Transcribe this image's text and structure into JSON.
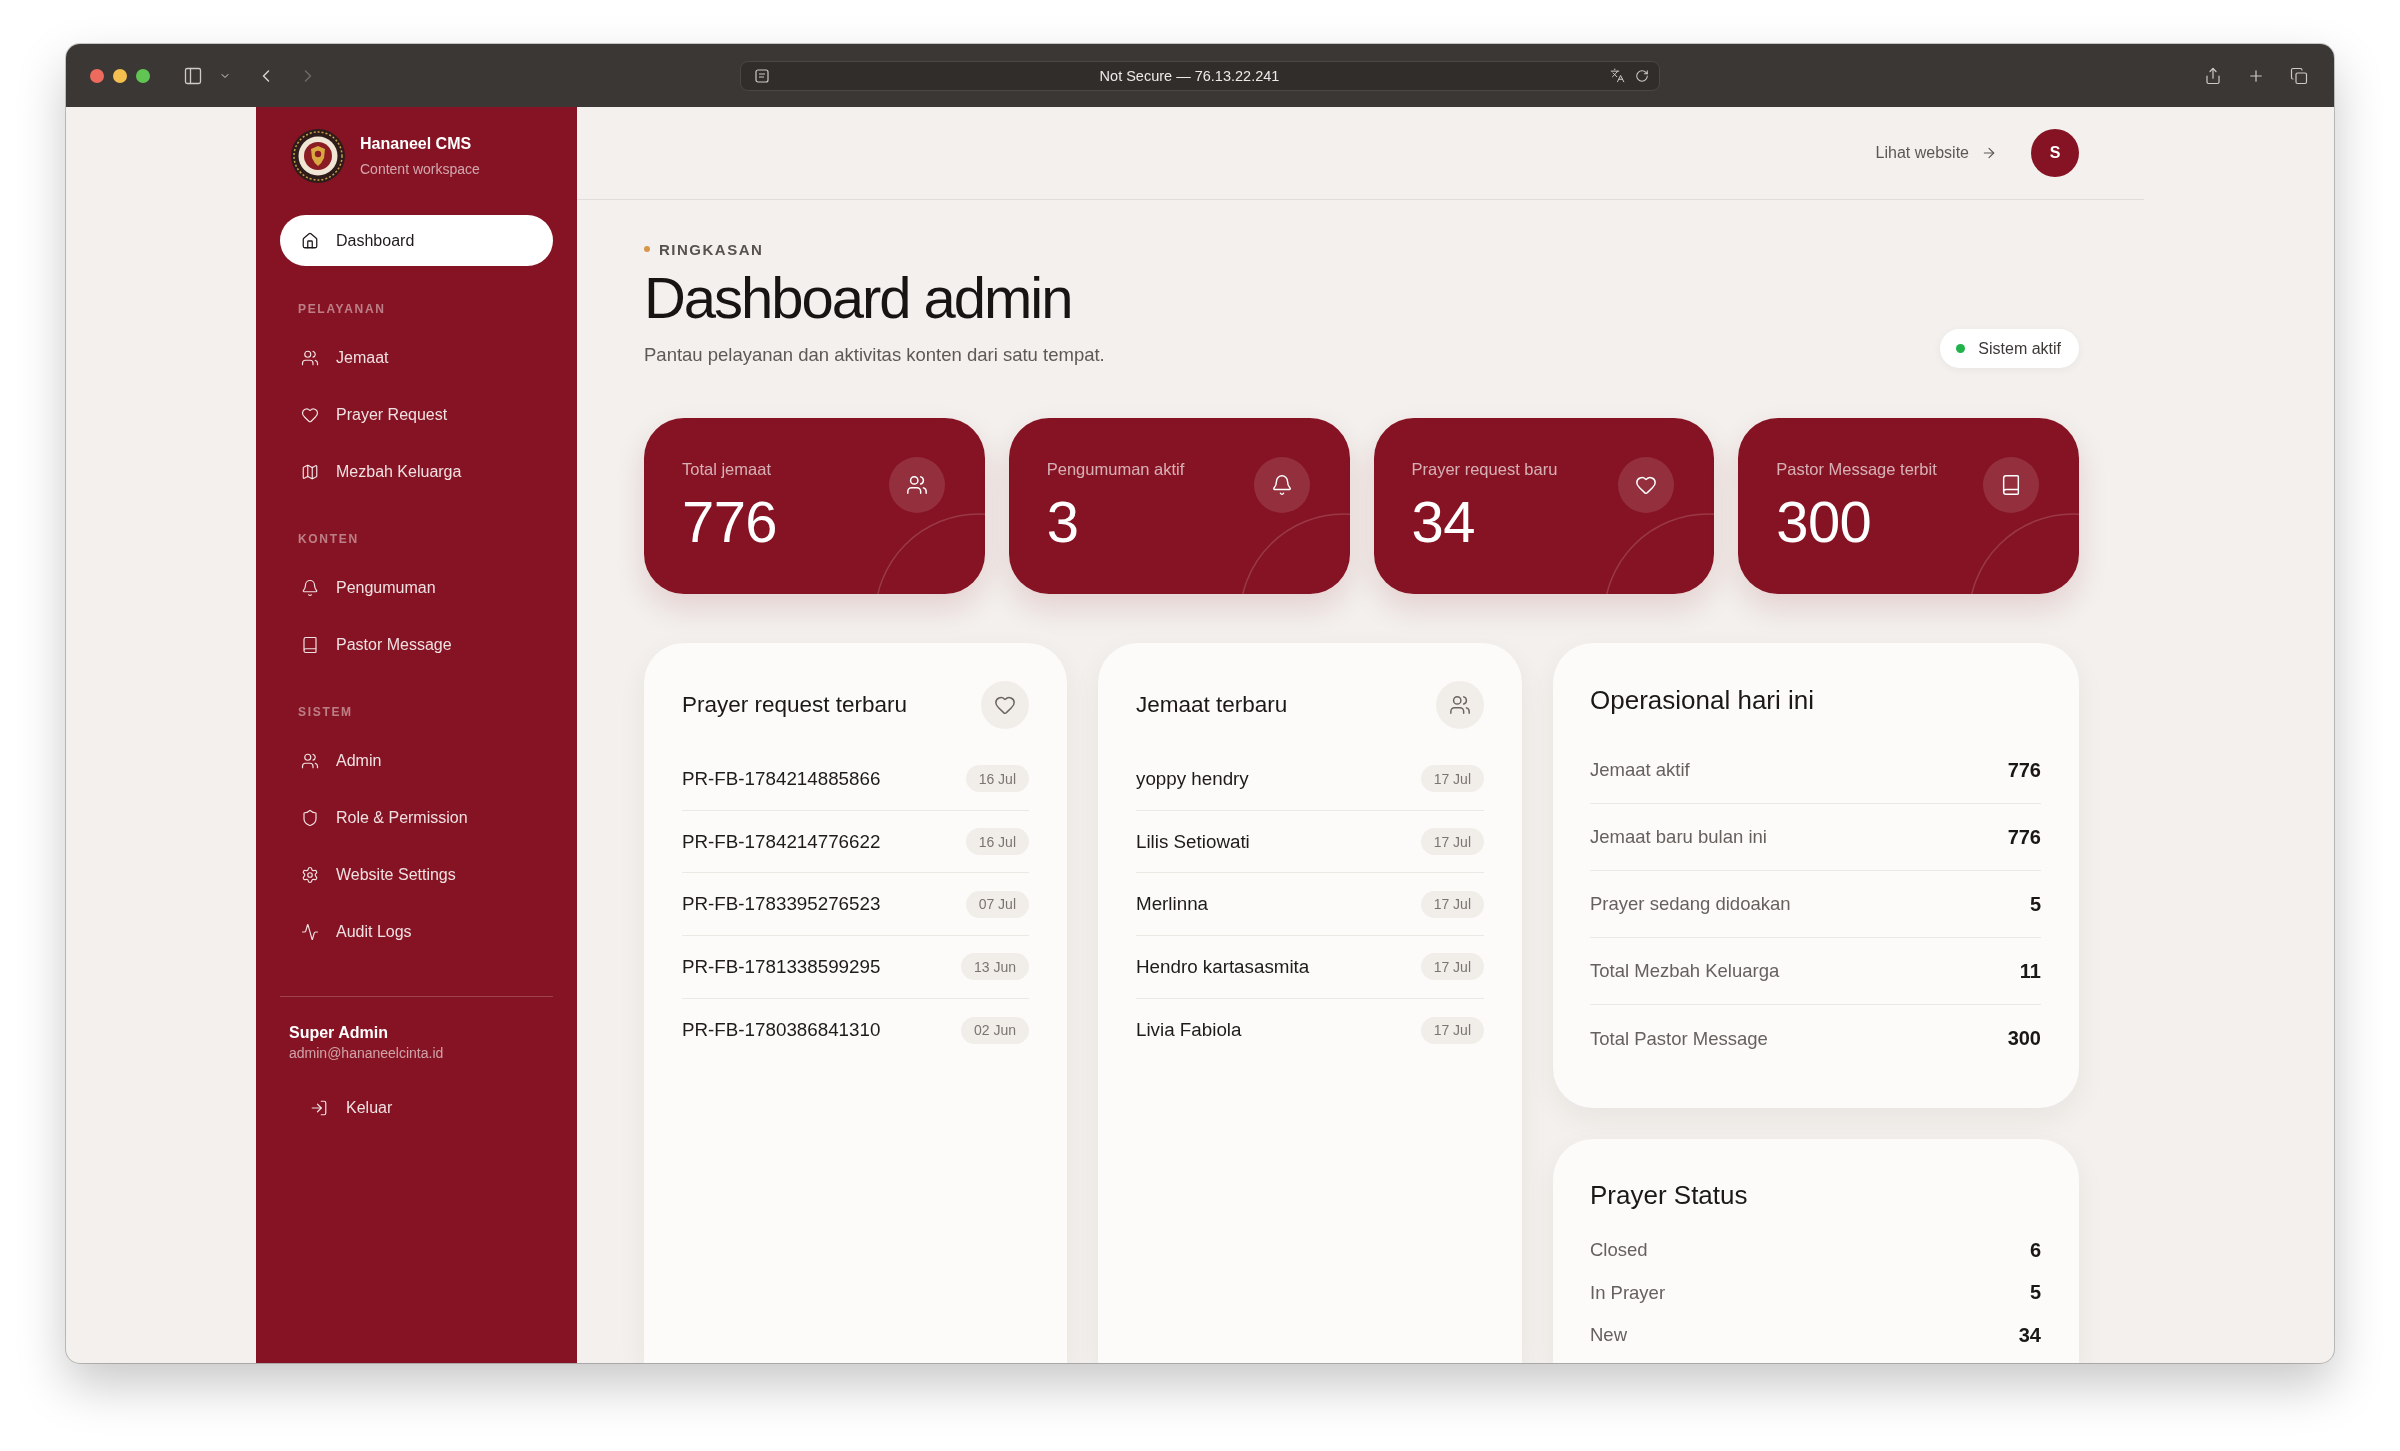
{
  "browser": {
    "nav": [
      {
        "kind": "back",
        "disabled": false
      },
      {
        "kind": "forward",
        "disabled": true
      }
    ],
    "address": "Not Secure — 76.13.22.241"
  },
  "sidebar": {
    "brand": {
      "name": "Hananeel CMS",
      "tagline": "Content workspace"
    },
    "home": {
      "label": "Dashboard",
      "selected": true
    },
    "sections": [
      {
        "title": "PELAYANAN",
        "items": [
          {
            "label": "Jemaat",
            "selected": false
          },
          {
            "label": "Prayer Request",
            "selected": false
          },
          {
            "label": "Mezbah Keluarga",
            "selected": false
          }
        ]
      },
      {
        "title": "KONTEN",
        "items": [
          {
            "label": "Pengumuman",
            "selected": false
          },
          {
            "label": "Pastor Message",
            "selected": false
          }
        ]
      },
      {
        "title": "SISTEM",
        "items": [
          {
            "label": "Admin",
            "selected": false
          },
          {
            "label": "Role & Permission",
            "selected": false
          },
          {
            "label": "Website Settings",
            "selected": false
          },
          {
            "label": "Audit Logs",
            "selected": false
          }
        ]
      }
    ],
    "user": {
      "name": "Super Admin",
      "email": "admin@hananeelcinta.id"
    },
    "logout": {
      "label": "Keluar"
    }
  },
  "header": {
    "site_link": "Lihat website",
    "avatar_initial": "S"
  },
  "overview": {
    "eyebrow": "RINGKASAN",
    "title": "Dashboard admin",
    "subtitle": "Pantau pelayanan dan aktivitas konten dari satu tempat.",
    "status": {
      "label": "Sistem aktif",
      "active": true
    }
  },
  "stats": [
    {
      "label": "Total jemaat",
      "value": "776"
    },
    {
      "label": "Pengumuman aktif",
      "value": "3"
    },
    {
      "label": "Prayer request baru",
      "value": "34"
    },
    {
      "label": "Pastor Message terbit",
      "value": "300"
    }
  ],
  "prayer_requests": {
    "title": "Prayer request terbaru",
    "rows": [
      {
        "code": "PR-FB-1784214885866",
        "date": "16 Jul"
      },
      {
        "code": "PR-FB-1784214776622",
        "date": "16 Jul"
      },
      {
        "code": "PR-FB-1783395276523",
        "date": "07 Jul"
      },
      {
        "code": "PR-FB-1781338599295",
        "date": "13 Jun"
      },
      {
        "code": "PR-FB-1780386841310",
        "date": "02 Jun"
      }
    ]
  },
  "new_members": {
    "title": "Jemaat terbaru",
    "rows": [
      {
        "name": "yoppy hendry",
        "date": "17 Jul"
      },
      {
        "name": "Lilis Setiowati",
        "date": "17 Jul"
      },
      {
        "name": "Merlinna",
        "date": "17 Jul"
      },
      {
        "name": "Hendro kartasasmita",
        "date": "17 Jul"
      },
      {
        "name": "Livia Fabiola",
        "date": "17 Jul"
      }
    ]
  },
  "operations": {
    "title": "Operasional hari ini",
    "rows": [
      {
        "label": "Jemaat aktif",
        "value": "776"
      },
      {
        "label": "Jemaat baru bulan ini",
        "value": "776"
      },
      {
        "label": "Prayer sedang didoakan",
        "value": "5"
      },
      {
        "label": "Total Mezbah Keluarga",
        "value": "11"
      },
      {
        "label": "Total Pastor Message",
        "value": "300"
      }
    ]
  },
  "prayer_status": {
    "title": "Prayer Status",
    "rows": [
      {
        "label": "Closed",
        "value": "6"
      },
      {
        "label": "In Prayer",
        "value": "5"
      },
      {
        "label": "New",
        "value": "34"
      }
    ]
  }
}
